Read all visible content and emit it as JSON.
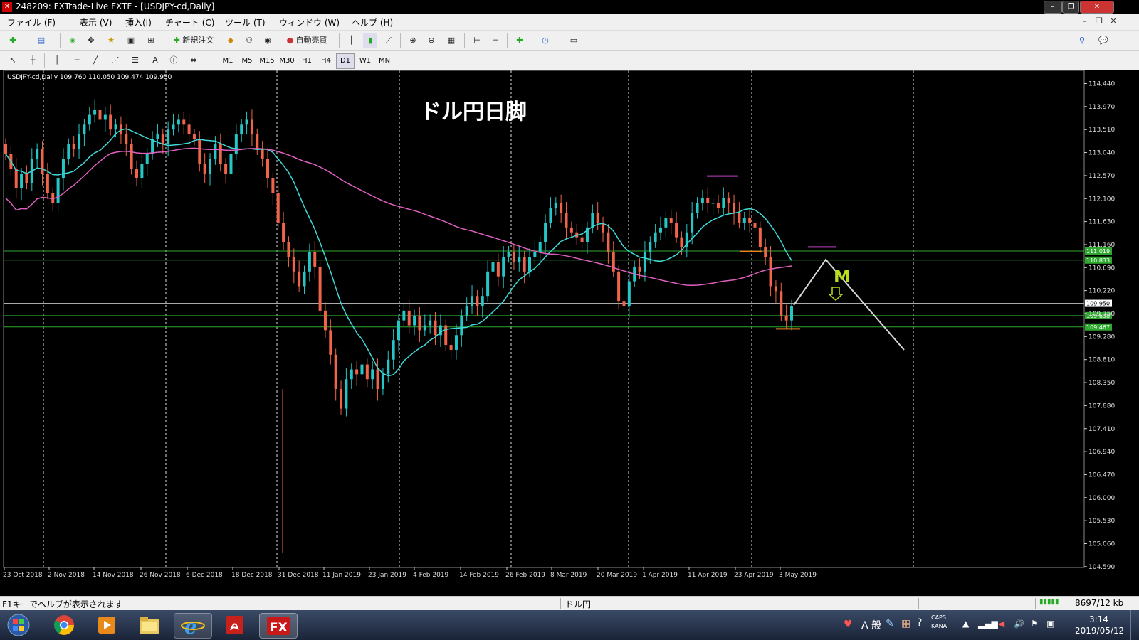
{
  "window": {
    "title": "248209: FXTrade-Live FXTF - [USDJPY-cd,Daily]"
  },
  "menu": [
    "ファイル (F)",
    "表示 (V)",
    "挿入(I)",
    "チャート (C)",
    "ツール (T)",
    "ウィンドウ (W)",
    "ヘルプ (H)"
  ],
  "toolbar": {
    "new_order": "新規注文",
    "auto_trade": "自動売買",
    "text_tool": "A",
    "timeframes": [
      "M1",
      "M5",
      "M15",
      "M30",
      "H1",
      "H4",
      "D1",
      "W1",
      "MN"
    ],
    "active_timeframe": "D1"
  },
  "chart": {
    "symbol_info": "USDJPY-cd,Daily  109.760 110.050 109.474 109.950",
    "annotation_title": "ドル円日脚",
    "pattern_label": "M",
    "price_labels": [
      "114.440",
      "113.970",
      "113.510",
      "113.040",
      "112.570",
      "112.100",
      "111.630",
      "111.160",
      "110.690",
      "110.220",
      "109.750",
      "109.280",
      "108.810",
      "108.350",
      "107.880",
      "107.410",
      "106.940",
      "106.470",
      "106.000",
      "105.530",
      "105.060",
      "104.590"
    ],
    "level_labels": [
      {
        "price": "111.019",
        "color": "#2fa82f"
      },
      {
        "price": "110.833",
        "color": "#2fa82f"
      },
      {
        "price": "109.950",
        "color": "#ffffff"
      },
      {
        "price": "109.698",
        "color": "#2fa82f"
      },
      {
        "price": "109.467",
        "color": "#2fa82f"
      }
    ],
    "date_labels": [
      "23 Oct 2018",
      "2 Nov 2018",
      "14 Nov 2018",
      "26 Nov 2018",
      "6 Dec 2018",
      "18 Dec 2018",
      "31 Dec 2018",
      "11 Jan 2019",
      "23 Jan 2019",
      "4 Feb 2019",
      "14 Feb 2019",
      "26 Feb 2019",
      "8 Mar 2019",
      "20 Mar 2019",
      "1 Apr 2019",
      "11 Apr 2019",
      "23 Apr 2019",
      "3 May 2019"
    ],
    "colors": {
      "bull": "#26c6c6",
      "bear": "#f0654a",
      "ma_fast": "#40d8d8",
      "ma_slow": "#e060c0",
      "level": "#2fa82f",
      "projection": "#d8d8d8",
      "pattern": "#b8e020"
    }
  },
  "status": {
    "help": "F1キーでヘルプが表示されます",
    "profile": "ドル円",
    "traffic": "8697/12 kb"
  },
  "taskbar": {
    "time": "3:14",
    "date": "2019/05/12",
    "ime": "A 般",
    "caps": "CAPS",
    "kana": "KANA",
    "fx_label": "FX"
  }
}
